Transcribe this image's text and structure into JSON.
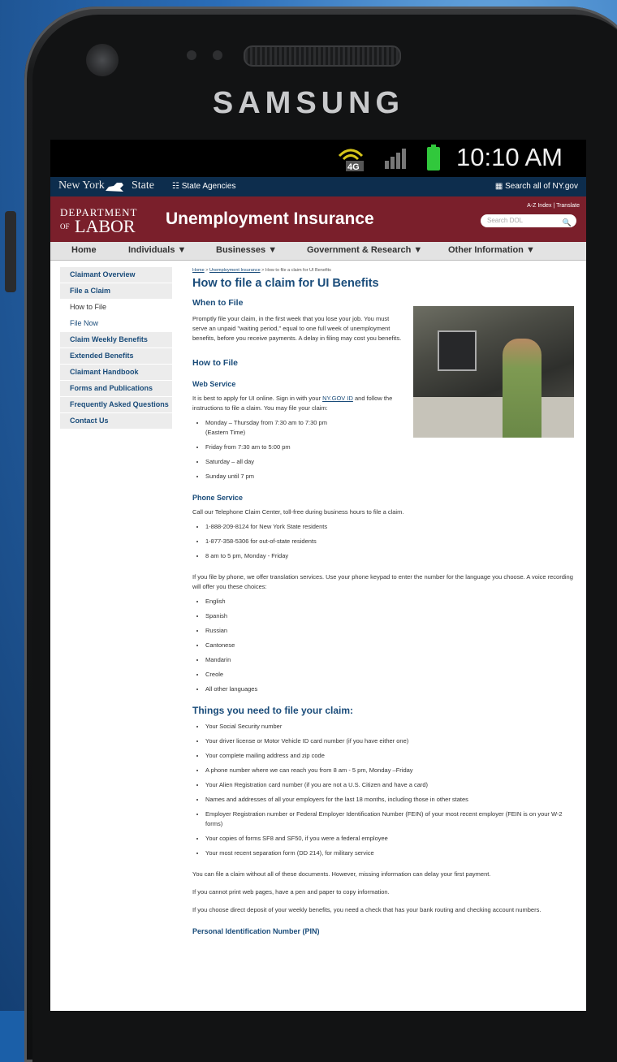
{
  "device": {
    "brand": "SAMSUNG",
    "status": {
      "network": "4G",
      "time": "10:10 AM"
    }
  },
  "nys_bar": {
    "logo_ny": "New York",
    "logo_state": "State",
    "agencies": "☷ State Agencies",
    "search": "▦ Search all of NY.gov"
  },
  "dol_header": {
    "logo_top": "DEPARTMENT",
    "logo_of": "OF",
    "logo_bottom": "LABOR",
    "title": "Unemployment Insurance",
    "links": "A-Z Index  |  Translate",
    "search_placeholder": "Search DOL"
  },
  "nav": [
    "Home",
    "Individuals ▼",
    "Businesses ▼",
    "Government & Research ▼",
    "Other Information ▼"
  ],
  "sidebar": [
    {
      "label": "Claimant Overview",
      "style": "bold"
    },
    {
      "label": "File a Claim",
      "style": "bold"
    },
    {
      "label": "How to File",
      "style": "plain"
    },
    {
      "label": "File Now",
      "style": "light"
    },
    {
      "label": "Claim Weekly Benefits",
      "style": "bold"
    },
    {
      "label": "Extended Benefits",
      "style": "bold"
    },
    {
      "label": "Claimant Handbook",
      "style": "bold"
    },
    {
      "label": "Forms and Publications",
      "style": "bold"
    },
    {
      "label": "Frequently Asked Questions",
      "style": "bold"
    },
    {
      "label": "Contact Us",
      "style": "bold"
    }
  ],
  "breadcrumb": {
    "home": "Home",
    "ui": "Unemployment Insurance",
    "current": "How to file a claim for UI Benefits"
  },
  "main": {
    "title": "How to file a claim for UI Benefits",
    "when_heading": "When to File",
    "when_text": "Promptly file your claim, in the first week that you lose your job. You must serve an unpaid \"waiting period,\" equal to one full week of unemployment benefits, before you receive payments. A delay in filing may cost you benefits.",
    "how_heading": "How to File",
    "web_heading": "Web Service",
    "web_text_1": "It is best to apply for UI online. Sign in with your",
    "web_link": "NY.GOV ID",
    "web_text_2": "and follow the instructions to file a claim.  You may file your claim:",
    "web_hours": [
      "Monday – Thursday from 7:30 am to 7:30 pm (Eastern Time)",
      "Friday from 7:30 am to 5:00 pm",
      "Saturday – all day",
      "Sunday until 7 pm"
    ],
    "phone_heading": "Phone Service",
    "phone_text": "Call our Telephone Claim Center, toll-free during business hours to file a claim.",
    "phone_items": [
      "1-888-209-8124 for New York State residents",
      "1-877-358-5306 for out-of-state residents",
      "8 am to 5 pm, Monday - Friday"
    ],
    "translation_text": "If you file by phone, we offer translation services. Use your phone keypad to enter the number for the language you choose.  A voice recording will offer you these choices:",
    "languages": [
      "English",
      "Spanish",
      "Russian",
      "Cantonese",
      "Mandarin",
      "Creole",
      "All other languages"
    ],
    "things_heading": "Things you need to file your claim:",
    "things": [
      "Your Social Security number",
      "Your driver license or Motor Vehicle ID card number (if you have either one)",
      "Your complete mailing address and zip code",
      "A phone number where we can reach you from 8 am - 5 pm, Monday –Friday",
      "Your Alien Registration card number (if you are not a U.S. Citizen and have a card)",
      "Names and addresses of all your employers for the last 18 months, including those in other states",
      "Employer Registration number or Federal Employer Identification Number (FEIN) of your most recent employer (FEIN is on your W-2 forms)",
      "Your copies of forms SF8 and SF50, if you were a federal employee",
      "Your most recent separation form (DD 214), for military service"
    ],
    "note_1": "You can file a claim without all of these documents. However, missing information can delay your first payment.",
    "note_2": "If you cannot print web pages, have a pen and paper to copy information.",
    "note_3": "If you choose direct deposit of your weekly benefits, you need a check that has your bank routing and checking account numbers.",
    "pin_heading": "Personal Identification Number (PIN)"
  }
}
